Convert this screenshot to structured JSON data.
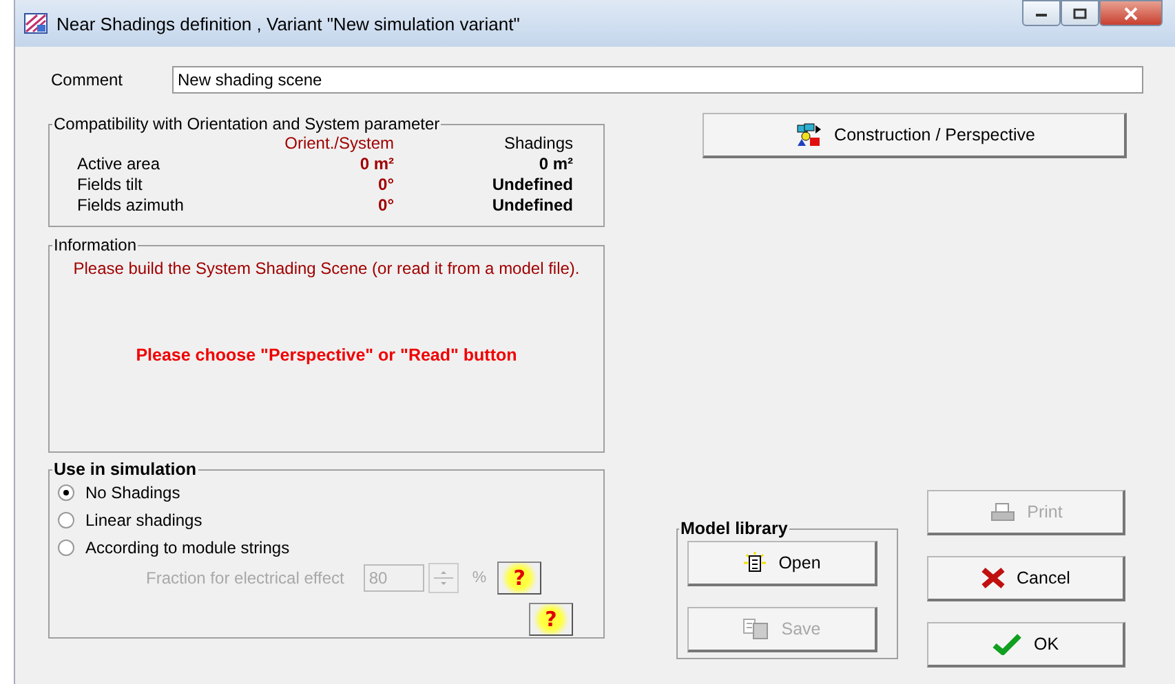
{
  "window": {
    "title": "Near Shadings definition , Variant \"New simulation variant\""
  },
  "comment": {
    "label": "Comment",
    "value": "New shading scene"
  },
  "compatibility": {
    "title": "Compatibility with Orientation and System parameter",
    "columns": [
      "Orient./System",
      "Shadings"
    ],
    "rows": [
      {
        "label": "Active area",
        "orient": "0 m²",
        "shadings": "0 m²"
      },
      {
        "label": "Fields tilt",
        "orient": "0°",
        "shadings": "Undefined"
      },
      {
        "label": "Fields azimuth",
        "orient": "0°",
        "shadings": "Undefined"
      }
    ]
  },
  "construction_button": {
    "label": "Construction / Perspective"
  },
  "information": {
    "title": "Information",
    "message": "Please build the System Shading Scene  (or read it from a model file).",
    "warning": "Please choose \"Perspective\" or \"Read\" button"
  },
  "use_in_simulation": {
    "title": "Use in simulation",
    "options": [
      {
        "label": "No Shadings",
        "selected": true
      },
      {
        "label": "Linear shadings",
        "selected": false
      },
      {
        "label": "According to module strings",
        "selected": false
      }
    ],
    "fraction": {
      "label": "Fraction for electrical effect",
      "value": "80",
      "unit": "%",
      "disabled": true
    },
    "help_buttons": [
      {
        "label": "?"
      },
      {
        "label": "?"
      }
    ]
  },
  "model_library": {
    "title": "Model library",
    "buttons": [
      {
        "label": "Open",
        "kind": "open",
        "disabled": false
      },
      {
        "label": "Save",
        "kind": "save",
        "disabled": true
      }
    ]
  },
  "buttons": [
    {
      "label": "Print",
      "kind": "print",
      "disabled": true
    },
    {
      "label": "Cancel",
      "kind": "cancel",
      "disabled": false
    },
    {
      "label": "OK",
      "kind": "ok",
      "disabled": false
    }
  ]
}
